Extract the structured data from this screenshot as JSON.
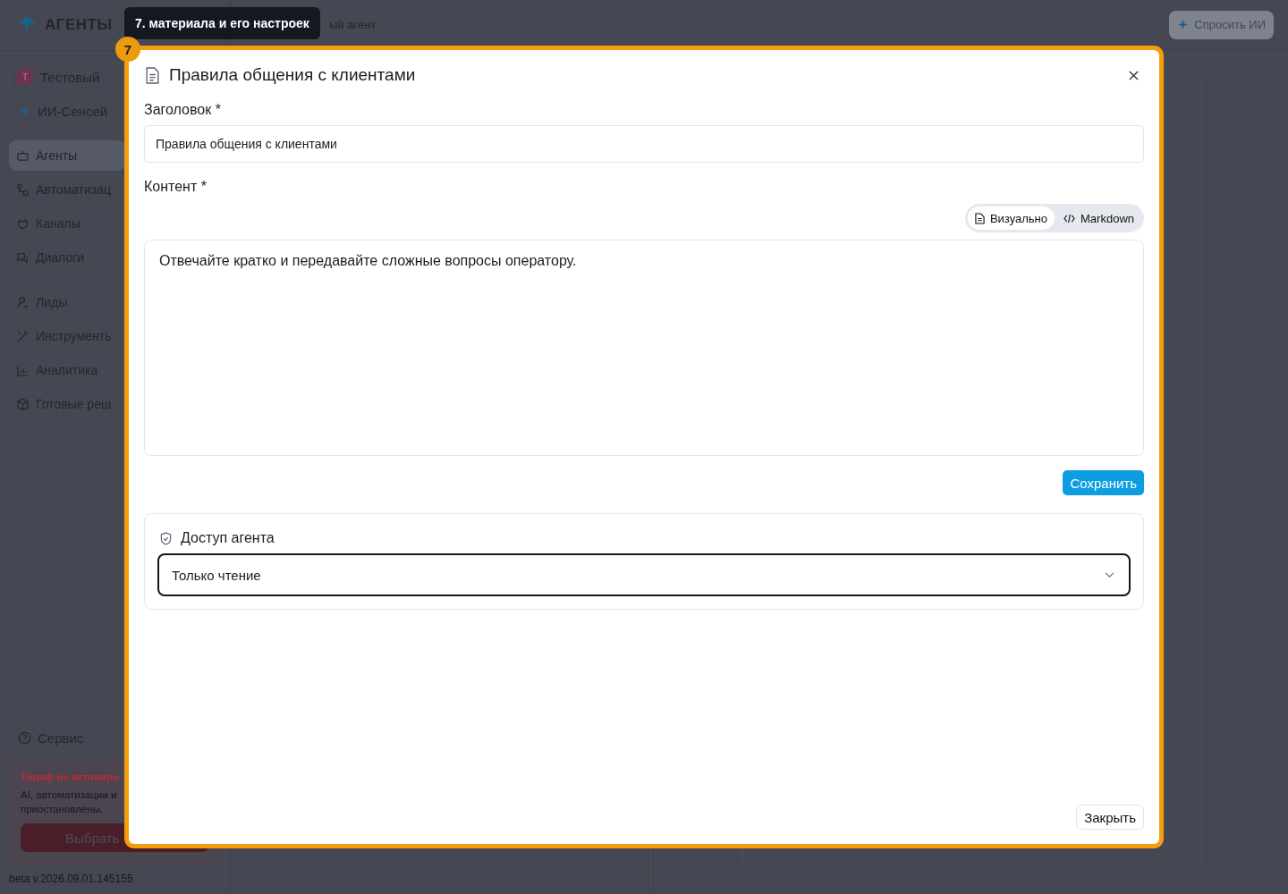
{
  "app": {
    "logo": "АГЕНТЫ",
    "breadcrumb": "ый агент",
    "ask_ai": "Спросить ИИ"
  },
  "sidebar": {
    "workspace": {
      "initial": "Т",
      "name": "Тестовый"
    },
    "ai_item": "ИИ-Сенсей",
    "groups": [
      [
        {
          "label": "Агенты",
          "selected": true
        },
        {
          "label": "Автоматизац",
          "selected": false
        },
        {
          "label": "Каналы",
          "selected": false
        },
        {
          "label": "Диалоги",
          "selected": false
        }
      ],
      [
        {
          "label": "Лиды",
          "selected": false
        },
        {
          "label": "Инструменть",
          "selected": false
        },
        {
          "label": "Аналитика",
          "selected": false
        },
        {
          "label": "Готовые реш",
          "selected": false
        }
      ]
    ],
    "service": "Сервис",
    "plan": {
      "title": "Тариф не активиро",
      "lines": [
        "AI, автоматизации и",
        "приостановлены."
      ],
      "button": "Выбрать"
    },
    "version": "beta v.2026.09.01.145155"
  },
  "tour": {
    "step": "7",
    "tooltip": "7. материала и его настроек"
  },
  "modal": {
    "title": "Правила общения с клиентами",
    "title_label": "Заголовок *",
    "title_value": "Правила общения с клиентами",
    "content_label": "Контент *",
    "modes": [
      {
        "label": "Визуально",
        "selected": true
      },
      {
        "label": "Markdown",
        "selected": false
      }
    ],
    "content": "Отвечайте кратко и передавайте сложные вопросы оператору.",
    "save": "Сохранить",
    "access": {
      "title": "Доступ агента",
      "value": "Только чтение",
      "focused": true
    },
    "close": "Закрыть"
  }
}
